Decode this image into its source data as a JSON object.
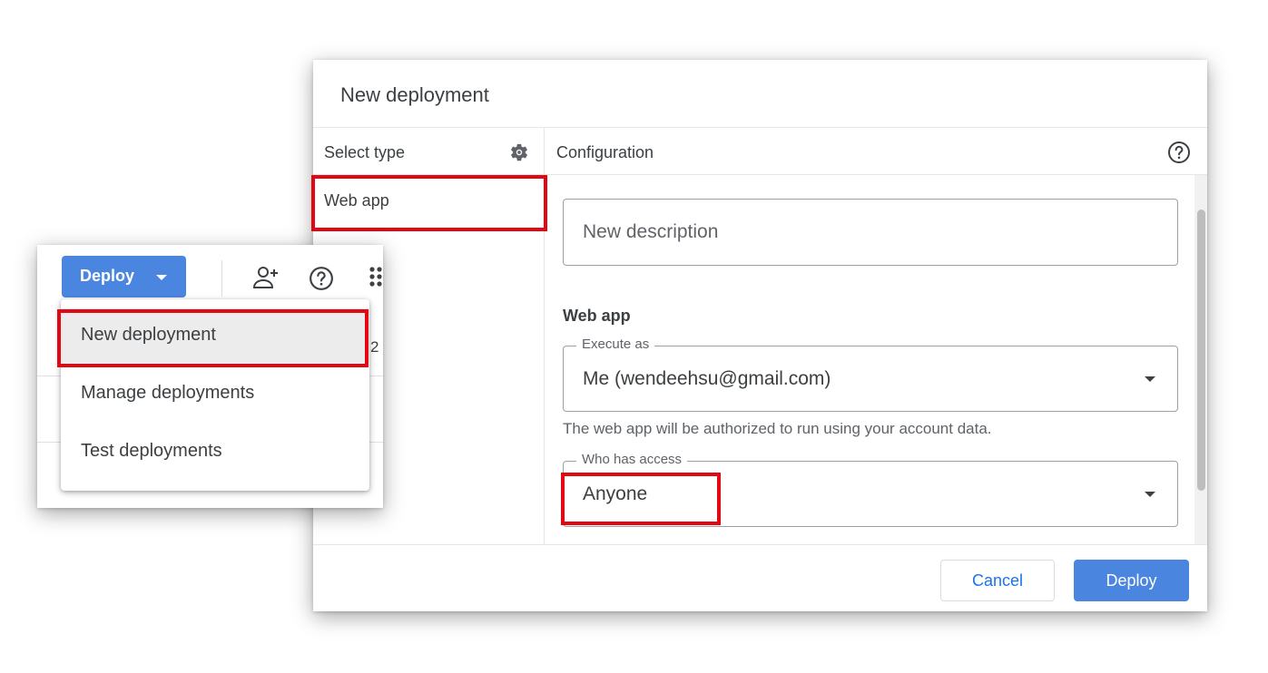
{
  "dialog": {
    "title": "New deployment",
    "select_type": {
      "header": "Select type",
      "items": [
        "Web app"
      ]
    },
    "configuration": {
      "header": "Configuration",
      "description_placeholder": "New description",
      "section_title": "Web app",
      "execute_as": {
        "label": "Execute as",
        "value": "Me (wendeehsu@gmail.com)"
      },
      "hint": "The web app will be authorized to run using your account data.",
      "who_has_access": {
        "label": "Who has access",
        "value": "Anyone"
      }
    },
    "footer": {
      "cancel_label": "Cancel",
      "deploy_label": "Deploy"
    }
  },
  "editor": {
    "deploy_button_label": "Deploy",
    "behind_text": "2",
    "menu": {
      "items": [
        "New deployment",
        "Manage deployments",
        "Test deployments"
      ]
    }
  },
  "colors": {
    "accent": "#4a86e0",
    "link": "#1a73e8",
    "highlight": "#e30613",
    "text": "#3c4043"
  }
}
